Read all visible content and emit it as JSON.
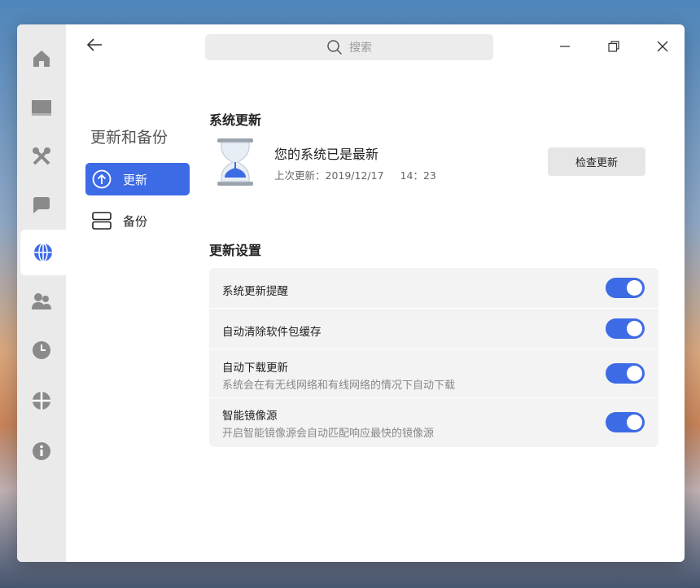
{
  "search": {
    "placeholder": "搜索"
  },
  "rail": {
    "items": [
      {
        "icon": "home-icon"
      },
      {
        "icon": "display-icon"
      },
      {
        "icon": "tools-icon"
      },
      {
        "icon": "chat-bubble-icon"
      },
      {
        "icon": "globe-icon",
        "active": true
      },
      {
        "icon": "users-icon"
      },
      {
        "icon": "clock-icon"
      },
      {
        "icon": "crosshair-icon"
      },
      {
        "icon": "info-icon"
      }
    ]
  },
  "nav": {
    "title": "更新和备份",
    "items": [
      {
        "label": "更新",
        "selected": true
      },
      {
        "label": "备份",
        "selected": false
      }
    ]
  },
  "update": {
    "section_title": "系统更新",
    "status": "您的系统已是最新",
    "last_update_label": "上次更新：2019/12/17",
    "last_update_time": "14：23",
    "check_button": "检查更新"
  },
  "settings": {
    "section_title": "更新设置",
    "items": [
      {
        "label": "系统更新提醒",
        "desc": "",
        "enabled": true
      },
      {
        "label": "自动清除软件包缓存",
        "desc": "",
        "enabled": true
      },
      {
        "label": "自动下载更新",
        "desc": "系统会在有无线网络和有线网络的情况下自动下载",
        "enabled": true
      },
      {
        "label": "智能镜像源",
        "desc": "开启智能镜像源会自动匹配响应最快的镜像源",
        "enabled": true
      }
    ]
  },
  "colors": {
    "accent": "#3d6be5",
    "rail_bg": "#eaeaea",
    "card_bg": "#f3f3f3"
  }
}
